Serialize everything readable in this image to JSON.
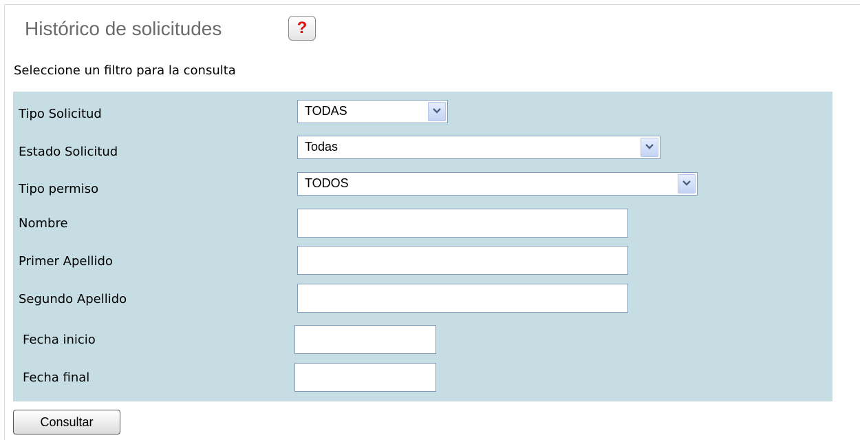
{
  "header": {
    "title": "Histórico de solicitudes",
    "help_label": "?"
  },
  "instructions": "Seleccione un filtro para la consulta",
  "filters": {
    "tipo_solicitud": {
      "label": "Tipo Solicitud",
      "value": "TODAS"
    },
    "estado_solicitud": {
      "label": "Estado Solicitud",
      "value": "Todas"
    },
    "tipo_permiso": {
      "label": "Tipo permiso",
      "value": "TODOS"
    },
    "nombre": {
      "label": "Nombre",
      "value": ""
    },
    "primer_apellido": {
      "label": "Primer Apellido",
      "value": ""
    },
    "segundo_apellido": {
      "label": "Segundo Apellido",
      "value": ""
    },
    "fecha_inicio": {
      "label": "Fecha inicio",
      "value": ""
    },
    "fecha_final": {
      "label": "Fecha final",
      "value": ""
    }
  },
  "actions": {
    "submit_label": "Consultar"
  },
  "colors": {
    "panel_background": "#c6dee3",
    "help_icon": "#e01010",
    "title_text": "#6b6b6b"
  }
}
